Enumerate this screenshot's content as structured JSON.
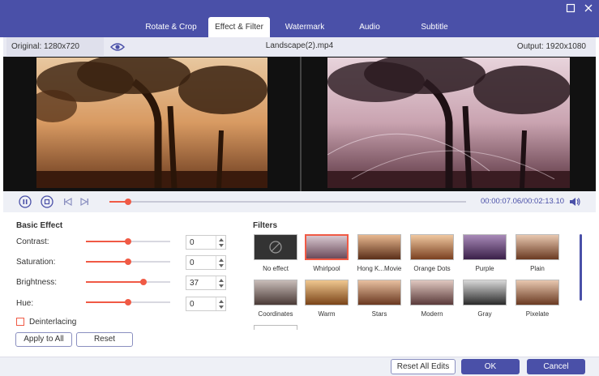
{
  "tabs": [
    {
      "label": "Rotate & Crop"
    },
    {
      "label": "Effect & Filter"
    },
    {
      "label": "Watermark"
    },
    {
      "label": "Audio"
    },
    {
      "label": "Subtitle"
    }
  ],
  "window": {
    "maximize_icon": "maximize-icon",
    "close_icon": "close-icon"
  },
  "info": {
    "original": "Original: 1280x720",
    "filename": "Landscape(2).mp4",
    "output": "Output: 1920x1080"
  },
  "player": {
    "timecode": "00:00:07.06/00:02:13.10",
    "progress_fraction": 0.053
  },
  "basic_effect": {
    "title": "Basic Effect",
    "contrast": {
      "label": "Contrast:",
      "value": "0",
      "level": 0.5
    },
    "saturation": {
      "label": "Saturation:",
      "value": "0",
      "level": 0.5
    },
    "brightness": {
      "label": "Brightness:",
      "value": "37",
      "level": 0.68
    },
    "hue": {
      "label": "Hue:",
      "value": "0",
      "level": 0.5
    },
    "deinterlacing": "Deinterlacing",
    "apply_all": "Apply to All",
    "reset": "Reset"
  },
  "filters": {
    "title": "Filters",
    "items": [
      {
        "label": "No effect"
      },
      {
        "label": "Whirlpool"
      },
      {
        "label": "Hong K...Movie"
      },
      {
        "label": "Orange Dots"
      },
      {
        "label": "Purple"
      },
      {
        "label": "Plain"
      },
      {
        "label": "Coordinates"
      },
      {
        "label": "Warm"
      },
      {
        "label": "Stars"
      },
      {
        "label": "Modern"
      },
      {
        "label": "Gray"
      },
      {
        "label": "Pixelate"
      }
    ]
  },
  "footer": {
    "reset_all": "Reset All Edits",
    "ok": "OK",
    "cancel": "Cancel"
  },
  "colors": {
    "accent": "#4a50a8",
    "highlight": "#f05a45"
  }
}
